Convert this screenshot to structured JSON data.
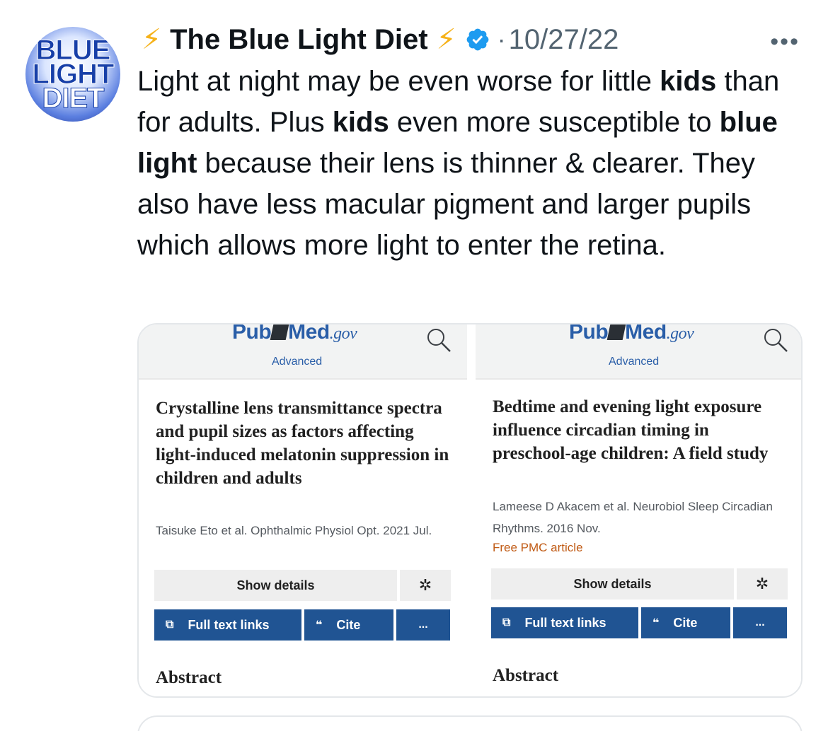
{
  "account": {
    "avatar_lines": [
      "BLUE",
      "LIGHT",
      "DIET"
    ],
    "name": "The Blue Light Diet",
    "lead_emoji": "⚡",
    "trail_emoji": "⚡",
    "separator": "·",
    "date": "10/27/22",
    "more_label": "•••",
    "verified_icon": "verified-badge-icon"
  },
  "tweet": {
    "parts": [
      {
        "text": "Light at night may be even worse for little ",
        "bold": false
      },
      {
        "text": "kids",
        "bold": true
      },
      {
        "text": " than for adults. Plus ",
        "bold": false
      },
      {
        "text": "kids",
        "bold": true
      },
      {
        "text": " even more susceptible to ",
        "bold": false
      },
      {
        "text": "blue light",
        "bold": true
      },
      {
        "text": " because their lens is thinner & clearer. They also have less macular pigment and larger pupils which allows more light to enter the retina.",
        "bold": false
      }
    ]
  },
  "cards": [
    {
      "logo_pub": "Pub",
      "logo_med": "Med",
      "logo_gov": ".gov",
      "advanced": "Advanced",
      "title": "Crystalline lens transmittance spectra and pupil sizes as factors affecting light-induced melatonin suppression in children and adults",
      "authors": "Taisuke Eto et al. Ophthalmic Physiol Opt. 2021 Jul.",
      "free_article": "",
      "show_details": "Show details",
      "full_text": "Full text links",
      "cite": "Cite",
      "more": "...",
      "abstract": "Abstract"
    },
    {
      "logo_pub": "Pub",
      "logo_med": "Med",
      "logo_gov": ".gov",
      "advanced": "Advanced",
      "title": "Bedtime and evening light exposure influence circadian timing in preschool-age children: A field study",
      "authors": "Lameese D Akacem et al. Neurobiol Sleep Circadian Rhythms. 2016 Nov.",
      "free_article": "Free PMC article",
      "show_details": "Show details",
      "full_text": "Full text links",
      "cite": "Cite",
      "more": "...",
      "abstract": "Abstract"
    }
  ],
  "colors": {
    "verified": "#1d9bf0",
    "bolt": "#f6b21a",
    "pubmed_blue": "#205493",
    "muted": "#536471"
  }
}
